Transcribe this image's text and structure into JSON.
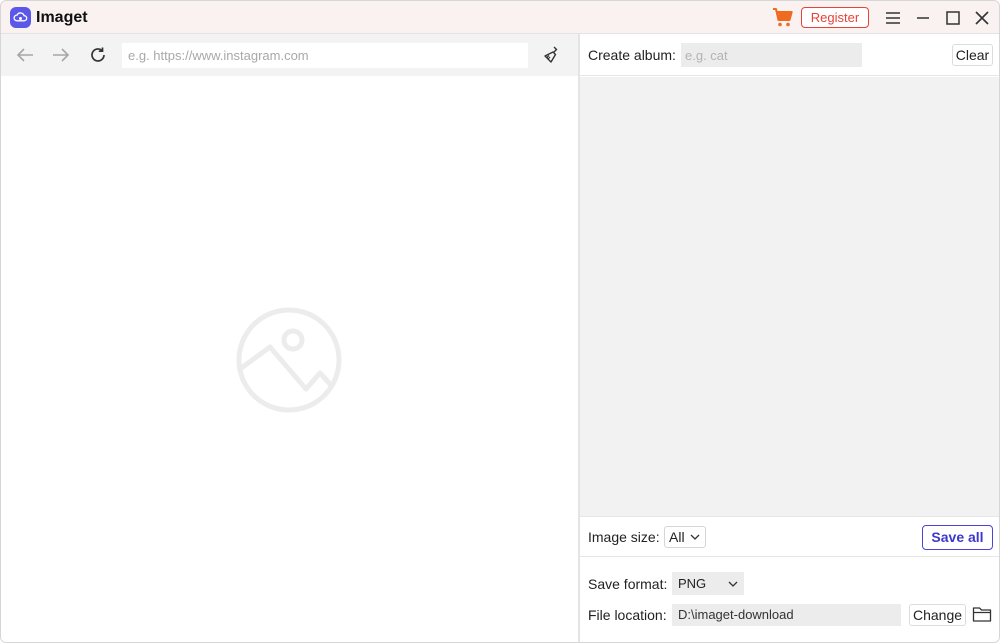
{
  "app": {
    "title": "Imaget"
  },
  "titlebar": {
    "register_label": "Register",
    "icons": [
      "imaget-logo-icon",
      "cart-icon",
      "hamburger-menu-icon",
      "minimize-icon",
      "maximize-icon",
      "close-icon"
    ],
    "accent_color": "#e8413a",
    "brand_color": "#5b57e8"
  },
  "browser": {
    "url_placeholder": "e.g. https://www.instagram.com",
    "url_value": "",
    "icons": [
      "back-arrow-icon",
      "forward-arrow-icon",
      "reload-icon",
      "clear-broom-icon",
      "image-placeholder-icon"
    ]
  },
  "album": {
    "label": "Create album:",
    "placeholder": "e.g. cat",
    "value": "",
    "clear_label": "Clear"
  },
  "image_size": {
    "label": "Image size:",
    "selected": "All"
  },
  "save_all_label": "Save all",
  "save_format": {
    "label": "Save format:",
    "selected": "PNG"
  },
  "file_location": {
    "label": "File location:",
    "value": "D:\\imaget-download",
    "change_label": "Change"
  }
}
